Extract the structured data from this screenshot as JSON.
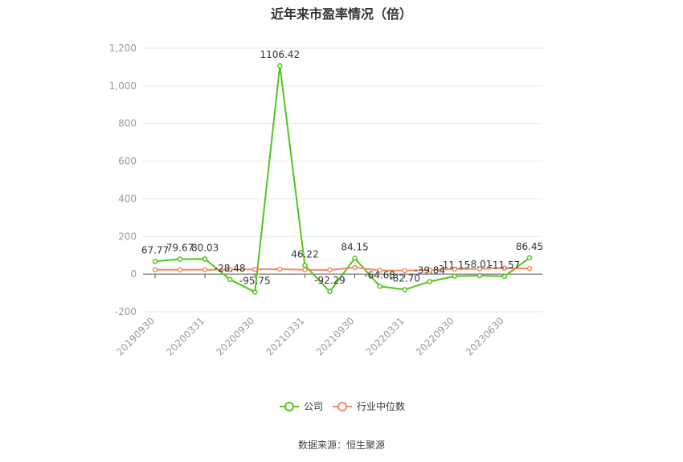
{
  "title": "近年来市盈率情况（倍）",
  "source": "数据来源：恒生聚源",
  "colors": {
    "company": "#52c41a",
    "industry": "#f08c64"
  },
  "chart_data": {
    "type": "line",
    "x": [
      "20190930",
      "20191231",
      "20200331",
      "20200630",
      "20200930",
      "20201231",
      "20210331",
      "20210630",
      "20210930",
      "20211231",
      "20220331",
      "20220630",
      "20220930",
      "20221231",
      "20230630",
      "20230930"
    ],
    "x_tick_labels": [
      "20190930",
      "20200331",
      "20200930",
      "20210331",
      "20210930",
      "20220331",
      "20220930",
      "20230630"
    ],
    "y_ticks": [
      "-200",
      "0",
      "200",
      "400",
      "600",
      "800",
      "1,000",
      "1,200"
    ],
    "ylim": [
      -200,
      1200
    ],
    "grid": true,
    "legend_position": "bottom",
    "series": [
      {
        "name": "公司",
        "values": [
          67.77,
          79.67,
          80.03,
          -28.48,
          -95.75,
          1106.42,
          46.22,
          -92.29,
          84.15,
          -64.68,
          -82.7,
          -39.84,
          -11.15,
          -8.01,
          -11.57,
          86.45
        ],
        "labels": [
          "67.77",
          "79.67",
          "80.03",
          "-28.48",
          "-95.75",
          "1106.42",
          "46.22",
          "-92.29",
          "84.15",
          "-64.68",
          "-82.70",
          "-39.84",
          "-11.15",
          "-8.01",
          "-11.57",
          "86.45"
        ]
      },
      {
        "name": "行业中位数",
        "values": [
          23,
          23,
          23,
          24,
          25,
          26,
          23,
          22,
          35,
          20,
          18,
          22,
          26,
          28,
          32,
          30
        ]
      }
    ]
  }
}
